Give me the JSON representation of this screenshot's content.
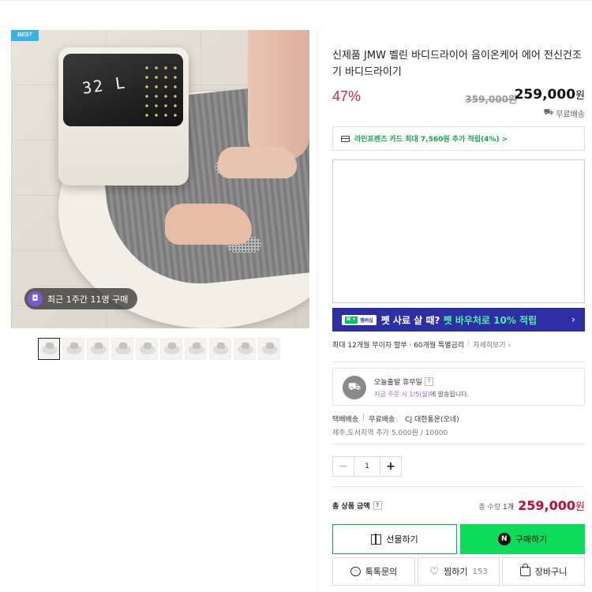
{
  "gallery": {
    "badge": "BEST",
    "device_readout": "32 L",
    "recent_purchase": "최근 1주간 11명 구매",
    "thumbnail_count": 10
  },
  "product": {
    "title": "신제품 JMW 벨린 바디드라이어 음이온케어 에어 전신건조기 바디드라이기",
    "discount": "47%",
    "original_price": "359,000원",
    "price": "259,000",
    "price_unit": "원",
    "shipping": "무료배송"
  },
  "card_benefit": {
    "text": "라인프렌즈 카드 최대 7,560원 추가 적립(4%) >"
  },
  "banner": {
    "badge_n": "N +",
    "badge_text": "멤버십",
    "text": "펫 사료 살 때?",
    "highlight": "펫 바우처로 10% 적립",
    "arrow": "›"
  },
  "installment": {
    "text": "최대 12개월 무이자 할부 · 60개월 특별금리",
    "more": "자세히보기 ›"
  },
  "shipping_info": {
    "title": "오늘출발 휴무일",
    "help": "?",
    "sub_purple": "지금 주문 시 1/5(월)",
    "sub_rest": "에 발송됩니다.",
    "method": "택배배송",
    "fee": "무료배송",
    "carrier": "CJ 대한통운(오네)",
    "extra": "제주,도서지역 추가 5,000원 / 10000"
  },
  "quantity": {
    "minus": "−",
    "value": "1",
    "plus": "+"
  },
  "total": {
    "label": "총 상품 금액",
    "help": "?",
    "count_label": "총 수량",
    "count": "1개",
    "price": "259,000",
    "unit": "원"
  },
  "buttons": {
    "gift": "선물하기",
    "buy": "구매하기",
    "npay": "N",
    "talk": "톡톡문의",
    "wish": "찜하기",
    "wish_count": "153",
    "cart": "장바구니"
  },
  "colors": {
    "discount": "#e0254c",
    "naver_green": "#0ddb59",
    "banner_bg": "#2c2fa3",
    "total_price": "#c9082e"
  }
}
